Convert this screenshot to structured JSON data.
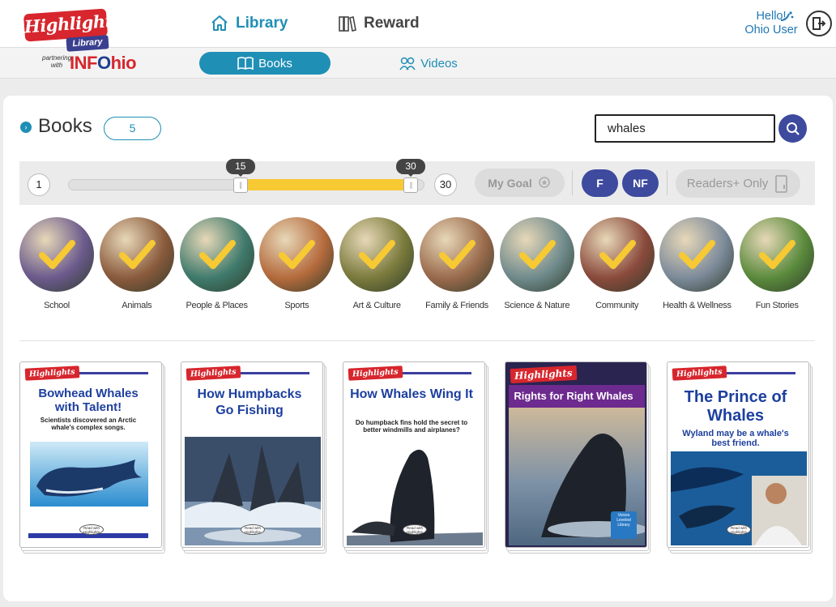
{
  "brand": {
    "name": "Highlights",
    "sub": "Library",
    "partner_text": "partnering with",
    "partner_pre": "INF",
    "partner_o": "O",
    "partner_post": "hio"
  },
  "nav": {
    "library": "Library",
    "reward": "Reward",
    "books": "Books",
    "videos": "Videos"
  },
  "user": {
    "hello": "Hello!",
    "name": "Ohio User"
  },
  "books_section": {
    "title": "Books",
    "count": "5",
    "search_value": "whales"
  },
  "filters": {
    "range_min": "1",
    "range_max": "30",
    "selected_low": "15",
    "selected_high": "30",
    "low_fraction": 0.483,
    "high_fraction": 1.0,
    "my_goal": "My Goal",
    "fiction": "F",
    "nonfiction": "NF",
    "readers_only": "Readers+ Only"
  },
  "categories": [
    {
      "label": "School",
      "color": "#6b5a8c"
    },
    {
      "label": "Animals",
      "color": "#8a5a3c"
    },
    {
      "label": "People & Places",
      "color": "#3f7a6c"
    },
    {
      "label": "Sports",
      "color": "#b46a3c"
    },
    {
      "label": "Art & Culture",
      "color": "#7a7a3c"
    },
    {
      "label": "Family & Friends",
      "color": "#9a6a4c"
    },
    {
      "label": "Science & Nature",
      "color": "#6f8a8c"
    },
    {
      "label": "Community",
      "color": "#8a4a3c"
    },
    {
      "label": "Health & Wellness",
      "color": "#7c8a9a"
    },
    {
      "label": "Fun Stories",
      "color": "#5a8a3c"
    }
  ],
  "books": [
    {
      "title": "Bowhead Whales with Talent!",
      "subtitle": "Scientists discovered an Arctic whale's complex songs."
    },
    {
      "title": "How Humpbacks Go Fishing",
      "subtitle": ""
    },
    {
      "title": "How Whales Wing It",
      "subtitle": "Do humpback fins hold the secret to better windmills and airplanes?"
    },
    {
      "title": "Rights for Right Whales",
      "subtitle": ""
    },
    {
      "title": "The Prince of Whales",
      "subtitle": "Wyland may be a whale's best friend."
    }
  ],
  "badge_text": "Read with Highlights",
  "leveled_badge": "Voices Leveled Library",
  "colors": {
    "accent": "#1f8fb5",
    "navy": "#3d4a9e",
    "yellow": "#f7c933",
    "brand_red": "#d7262d"
  },
  "icons": [
    "home-icon",
    "books-stack-icon",
    "open-book-icon",
    "video-people-icon",
    "search-icon",
    "logout-icon",
    "ribbon-icon",
    "reader-device-icon",
    "checkmark-icon"
  ]
}
